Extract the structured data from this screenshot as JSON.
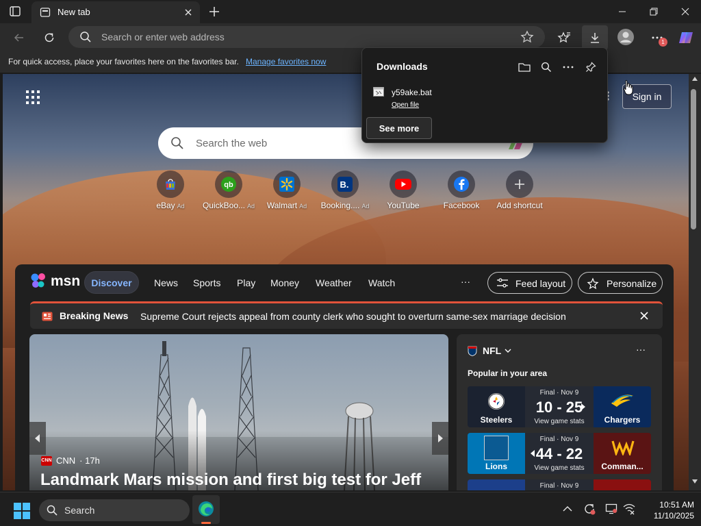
{
  "browser": {
    "tab_title": "New tab",
    "address_placeholder": "Search or enter web address",
    "favorites_bar_message": "For quick access, place your favorites here on the favorites bar.",
    "favorites_bar_link": "Manage favorites now",
    "profile_badge": "1"
  },
  "downloads": {
    "title": "Downloads",
    "file_name": "y59ake.bat",
    "open_file_label": "Open file",
    "see_more_label": "See more"
  },
  "newtab": {
    "sign_in_label": "Sign in",
    "search_placeholder": "Search the web",
    "ad_label": "Ad",
    "shortcuts": [
      {
        "label": "eBay",
        "ad": true,
        "icon": "ebay-icon",
        "color": "#2b6fd6"
      },
      {
        "label": "QuickBoo...",
        "ad": true,
        "icon": "quickbooks-icon",
        "color": "#2ca01c"
      },
      {
        "label": "Walmart",
        "ad": true,
        "icon": "walmart-icon",
        "color": "#0071ce"
      },
      {
        "label": "Booking....",
        "ad": true,
        "icon": "booking-icon",
        "color": "#003580"
      },
      {
        "label": "YouTube",
        "ad": false,
        "icon": "youtube-icon",
        "color": "#ff0000"
      },
      {
        "label": "Facebook",
        "ad": false,
        "icon": "facebook-icon",
        "color": "#1877f2"
      },
      {
        "label": "Add shortcut",
        "ad": false,
        "icon": "plus-icon",
        "color": "#ffffff"
      }
    ]
  },
  "msn": {
    "logo_text": "msn",
    "tabs": [
      "Discover",
      "News",
      "Sports",
      "Play",
      "Money",
      "Weather",
      "Watch"
    ],
    "more_label": "···",
    "feed_layout_label": "Feed layout",
    "personalize_label": "Personalize",
    "breaking_tag": "Breaking News",
    "breaking_headline": "Supreme Court rejects appeal from county clerk who sought to overturn same-sex marriage decision"
  },
  "hero": {
    "source": "CNN",
    "age": "· 17h",
    "title": "Landmark Mars mission and first big test for Jeff"
  },
  "nfl": {
    "title": "NFL",
    "subtitle": "Popular in your area",
    "more_label": "···",
    "games": [
      {
        "status": "Final · Nov 9",
        "score": "10 - 25",
        "stats": "View game stats",
        "team_left": "Steelers",
        "team_right": "Chargers",
        "color_left": "#1b2230",
        "color_right": "#0a2a5c"
      },
      {
        "status": "Final · Nov 9",
        "score": "44 - 22",
        "stats": "View game stats",
        "team_left": "Lions",
        "team_right": "Comman...",
        "color_left": "#0076b6",
        "color_right": "#5a1414"
      },
      {
        "status": "Final · Nov 9",
        "score": "",
        "stats": "",
        "team_left": "",
        "team_right": "",
        "color_left": "#1c3f8a",
        "color_right": "#8a1010"
      }
    ]
  },
  "taskbar": {
    "search_label": "Search",
    "time": "10:51 AM",
    "date": "11/10/2025"
  }
}
